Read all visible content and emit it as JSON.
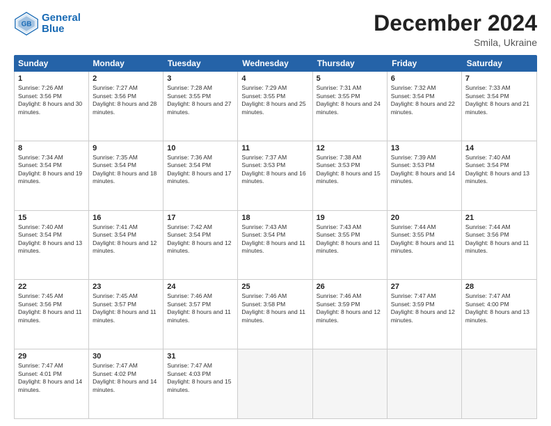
{
  "logo": {
    "line1": "General",
    "line2": "Blue"
  },
  "title": "December 2024",
  "location": "Smila, Ukraine",
  "days_header": [
    "Sunday",
    "Monday",
    "Tuesday",
    "Wednesday",
    "Thursday",
    "Friday",
    "Saturday"
  ],
  "weeks": [
    [
      {
        "day": "1",
        "sunrise": "7:26 AM",
        "sunset": "3:56 PM",
        "daylight": "8 hours and 30 minutes."
      },
      {
        "day": "2",
        "sunrise": "7:27 AM",
        "sunset": "3:56 PM",
        "daylight": "8 hours and 28 minutes."
      },
      {
        "day": "3",
        "sunrise": "7:28 AM",
        "sunset": "3:55 PM",
        "daylight": "8 hours and 27 minutes."
      },
      {
        "day": "4",
        "sunrise": "7:29 AM",
        "sunset": "3:55 PM",
        "daylight": "8 hours and 25 minutes."
      },
      {
        "day": "5",
        "sunrise": "7:31 AM",
        "sunset": "3:55 PM",
        "daylight": "8 hours and 24 minutes."
      },
      {
        "day": "6",
        "sunrise": "7:32 AM",
        "sunset": "3:54 PM",
        "daylight": "8 hours and 22 minutes."
      },
      {
        "day": "7",
        "sunrise": "7:33 AM",
        "sunset": "3:54 PM",
        "daylight": "8 hours and 21 minutes."
      }
    ],
    [
      {
        "day": "8",
        "sunrise": "7:34 AM",
        "sunset": "3:54 PM",
        "daylight": "8 hours and 19 minutes."
      },
      {
        "day": "9",
        "sunrise": "7:35 AM",
        "sunset": "3:54 PM",
        "daylight": "8 hours and 18 minutes."
      },
      {
        "day": "10",
        "sunrise": "7:36 AM",
        "sunset": "3:54 PM",
        "daylight": "8 hours and 17 minutes."
      },
      {
        "day": "11",
        "sunrise": "7:37 AM",
        "sunset": "3:53 PM",
        "daylight": "8 hours and 16 minutes."
      },
      {
        "day": "12",
        "sunrise": "7:38 AM",
        "sunset": "3:53 PM",
        "daylight": "8 hours and 15 minutes."
      },
      {
        "day": "13",
        "sunrise": "7:39 AM",
        "sunset": "3:53 PM",
        "daylight": "8 hours and 14 minutes."
      },
      {
        "day": "14",
        "sunrise": "7:40 AM",
        "sunset": "3:54 PM",
        "daylight": "8 hours and 13 minutes."
      }
    ],
    [
      {
        "day": "15",
        "sunrise": "7:40 AM",
        "sunset": "3:54 PM",
        "daylight": "8 hours and 13 minutes."
      },
      {
        "day": "16",
        "sunrise": "7:41 AM",
        "sunset": "3:54 PM",
        "daylight": "8 hours and 12 minutes."
      },
      {
        "day": "17",
        "sunrise": "7:42 AM",
        "sunset": "3:54 PM",
        "daylight": "8 hours and 12 minutes."
      },
      {
        "day": "18",
        "sunrise": "7:43 AM",
        "sunset": "3:54 PM",
        "daylight": "8 hours and 11 minutes."
      },
      {
        "day": "19",
        "sunrise": "7:43 AM",
        "sunset": "3:55 PM",
        "daylight": "8 hours and 11 minutes."
      },
      {
        "day": "20",
        "sunrise": "7:44 AM",
        "sunset": "3:55 PM",
        "daylight": "8 hours and 11 minutes."
      },
      {
        "day": "21",
        "sunrise": "7:44 AM",
        "sunset": "3:56 PM",
        "daylight": "8 hours and 11 minutes."
      }
    ],
    [
      {
        "day": "22",
        "sunrise": "7:45 AM",
        "sunset": "3:56 PM",
        "daylight": "8 hours and 11 minutes."
      },
      {
        "day": "23",
        "sunrise": "7:45 AM",
        "sunset": "3:57 PM",
        "daylight": "8 hours and 11 minutes."
      },
      {
        "day": "24",
        "sunrise": "7:46 AM",
        "sunset": "3:57 PM",
        "daylight": "8 hours and 11 minutes."
      },
      {
        "day": "25",
        "sunrise": "7:46 AM",
        "sunset": "3:58 PM",
        "daylight": "8 hours and 11 minutes."
      },
      {
        "day": "26",
        "sunrise": "7:46 AM",
        "sunset": "3:59 PM",
        "daylight": "8 hours and 12 minutes."
      },
      {
        "day": "27",
        "sunrise": "7:47 AM",
        "sunset": "3:59 PM",
        "daylight": "8 hours and 12 minutes."
      },
      {
        "day": "28",
        "sunrise": "7:47 AM",
        "sunset": "4:00 PM",
        "daylight": "8 hours and 13 minutes."
      }
    ],
    [
      {
        "day": "29",
        "sunrise": "7:47 AM",
        "sunset": "4:01 PM",
        "daylight": "8 hours and 14 minutes."
      },
      {
        "day": "30",
        "sunrise": "7:47 AM",
        "sunset": "4:02 PM",
        "daylight": "8 hours and 14 minutes."
      },
      {
        "day": "31",
        "sunrise": "7:47 AM",
        "sunset": "4:03 PM",
        "daylight": "8 hours and 15 minutes."
      },
      null,
      null,
      null,
      null
    ]
  ]
}
